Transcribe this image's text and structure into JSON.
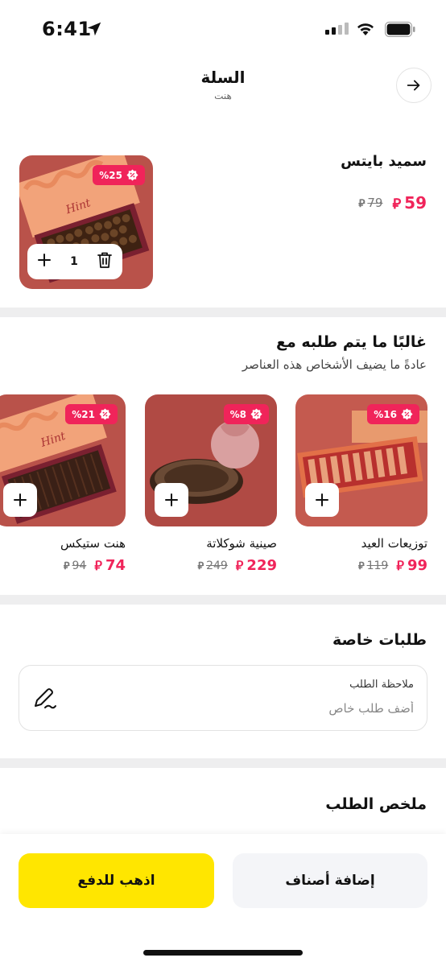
{
  "status_bar": {
    "time": "6:41"
  },
  "header": {
    "title": "السلة",
    "subtitle": "هنت"
  },
  "cart": {
    "item": {
      "name": "سميد بايتس",
      "price": "59",
      "old_price": "79",
      "discount": "%25",
      "quantity": "1"
    }
  },
  "recommendations": {
    "title": "غالبًا ما يتم طلبه مع",
    "subtitle": "عادةً ما يضيف الأشخاص هذه العناصر",
    "items": [
      {
        "name": "توزيعات العيد",
        "price": "99",
        "old_price": "119",
        "discount": "%16"
      },
      {
        "name": "صينية شوكلاتة",
        "price": "229",
        "old_price": "249",
        "discount": "%8"
      },
      {
        "name": "هنت ستيكس",
        "price": "74",
        "old_price": "94",
        "discount": "%21"
      }
    ]
  },
  "special_requests": {
    "title": "طلبات خاصة",
    "note_label": "ملاحظة الطلب",
    "note_placeholder": "أضف طلب خاص"
  },
  "summary": {
    "title": "ملخص الطلب"
  },
  "actions": {
    "pay_label": "اذهب للدفع",
    "add_items_label": "إضافة أصناف"
  },
  "colors": {
    "accent": "#f0245a",
    "primary_button": "#ffe600",
    "secondary_button": "#f4f5f8",
    "product_bg": "#b9524a"
  },
  "icons": [
    "location-arrow-icon",
    "signal-icon",
    "wifi-icon",
    "battery-icon",
    "arrow-right-icon",
    "discount-badge-icon",
    "trash-icon",
    "plus-icon",
    "pen-icon",
    "riyal-icon"
  ]
}
